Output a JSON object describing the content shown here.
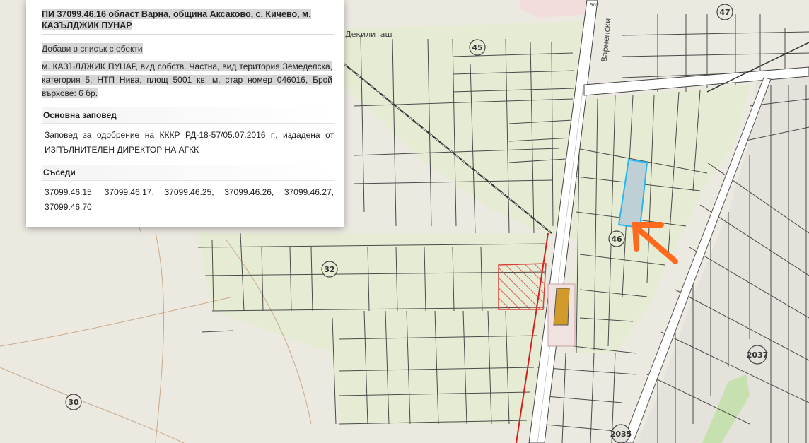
{
  "map": {
    "place_label": "Декилиташ",
    "road_label": "Варненски",
    "road_number": "902",
    "badges": [
      "47",
      "45",
      "46",
      "32",
      "30",
      "2037",
      "2035"
    ],
    "colors": {
      "background": "#ebe9e0",
      "agri_fill": "#e6ecd4",
      "parcel_line": "#4a4a4a",
      "selected_parcel_fill": "#bfcfd6",
      "selected_parcel_stroke": "#29b7ef",
      "hatch": "#d9413b",
      "orange_building": "#d19a2a",
      "arrow": "#ff6a1f",
      "red_boundary": "#d21f1f",
      "green_strip": "#c6e0b0"
    }
  },
  "info_panel": {
    "title": "ПИ 37099.46.16 област Варна, община Аксаково, с. Кичево, м. КАЗЪЛДЖИК ПУНАР",
    "add_to_list": "Добави в списък с обекти",
    "description": "м. КАЗЪЛДЖИК ПУНАР, вид собств. Частна, вид територия Земеделска, категория 5, НТП Нива, площ 5001 кв. м, стар номер 046016, Брой върхове: 6 бр.",
    "main_order": {
      "header": "Основна заповед",
      "text": "Заповед за одобрение на КККР РД-18-57/05.07.2016 г., издадена от ИЗПЪЛНИТЕЛЕН ДИРЕКТОР НА АГКК"
    },
    "neighbors": {
      "header": "Съседи",
      "text": "37099.46.15, 37099.46.17, 37099.46.25, 37099.46.26, 37099.46.27, 37099.46.70"
    }
  }
}
